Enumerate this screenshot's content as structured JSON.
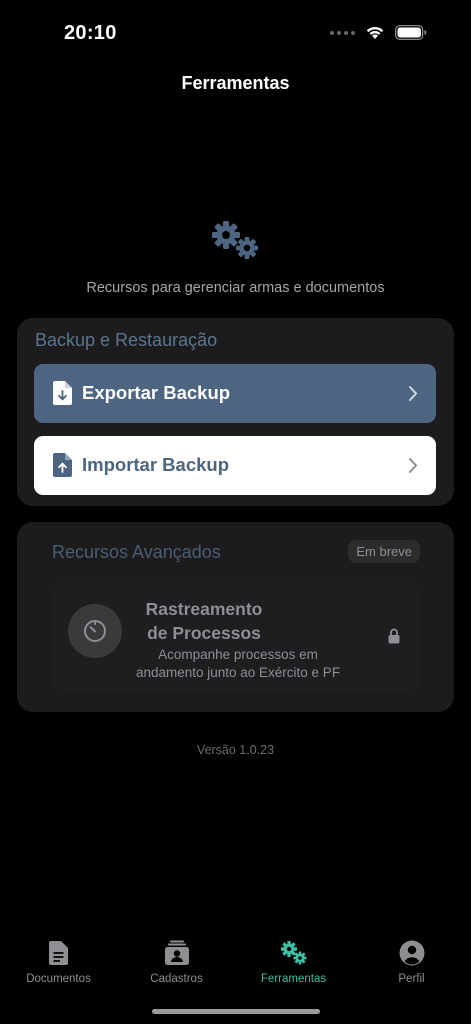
{
  "status_bar": {
    "time": "20:10"
  },
  "header": {
    "title": "Ferramentas"
  },
  "hero": {
    "icon": "gears-icon",
    "subtitle": "Recursos para gerenciar armas e documentos"
  },
  "backup": {
    "title": "Backup e Restauração",
    "export_label": "Exportar Backup",
    "import_label": "Importar Backup"
  },
  "advanced": {
    "title": "Recursos Avançados",
    "badge": "Em breve",
    "feature": {
      "title": "Rastreamento de Processos",
      "description": "Acompanhe processos em andamento junto ao Exército e PF",
      "locked": true
    }
  },
  "version": "Versão 1.0.23",
  "tabs": [
    {
      "label": "Documentos",
      "icon": "document-icon",
      "active": false
    },
    {
      "label": "Cadastros",
      "icon": "id-card-icon",
      "active": false
    },
    {
      "label": "Ferramentas",
      "icon": "gears-icon",
      "active": true
    },
    {
      "label": "Perfil",
      "icon": "profile-icon",
      "active": false
    }
  ],
  "colors": {
    "accent": "#3fbfa5",
    "primary_button": "#4d6580",
    "card": "#1c1c1e",
    "background": "#000000"
  }
}
